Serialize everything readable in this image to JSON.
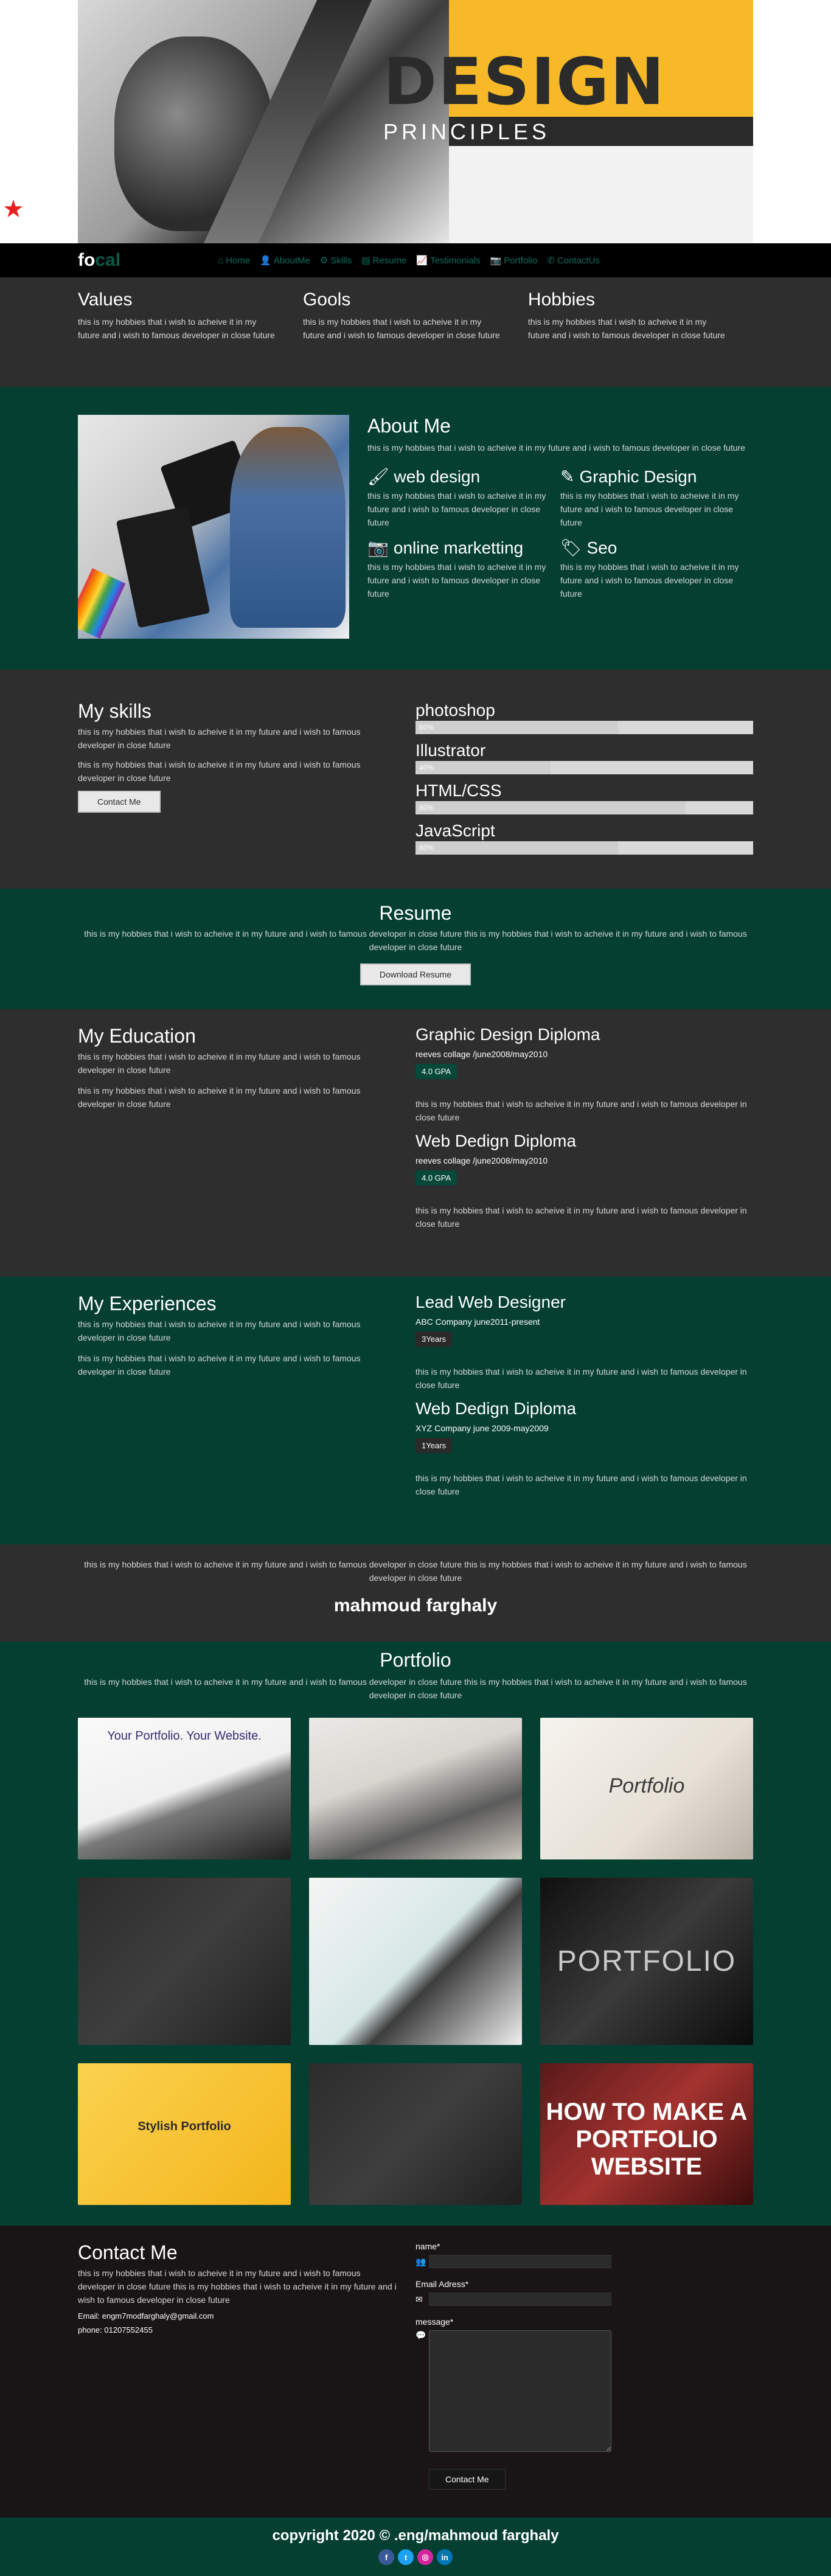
{
  "hero": {
    "word": "DESIGN",
    "sub": "PRINCIPLES"
  },
  "nav": {
    "brand_a": "fo",
    "brand_b": "cal",
    "items": [
      {
        "label": "Home",
        "icon": "home-icon"
      },
      {
        "label": "AboutMe",
        "icon": "user-icon"
      },
      {
        "label": "Skills",
        "icon": "gear-icon"
      },
      {
        "label": "Resume",
        "icon": "resume-icon"
      },
      {
        "label": "Testimonials",
        "icon": "chart-icon"
      },
      {
        "label": "Portfolio",
        "icon": "camera-icon"
      },
      {
        "label": "ContactUs",
        "icon": "phone-icon"
      }
    ]
  },
  "values": [
    {
      "title": "Values",
      "text": "this is my hobbies that i wish to acheive it in my future and i wish to famous developer in close future"
    },
    {
      "title": "Gools",
      "text": "this is my hobbies that i wish to acheive it in my future and i wish to famous developer in close future"
    },
    {
      "title": "Hobbies",
      "text": "this is my hobbies that i wish to acheive it in my future and i wish to famous developer in close future"
    }
  ],
  "about": {
    "title": "About Me",
    "text": "this is my hobbies that i wish to acheive it in my future and i wish to famous developer in close future",
    "cells": [
      {
        "title": "web design",
        "icon": "brush-icon",
        "text": "this is my hobbies that i wish to acheive it in my future and i wish to famous developer in close future"
      },
      {
        "title": "Graphic Design",
        "icon": "pen-icon",
        "text": "this is my hobbies that i wish to acheive it in my future and i wish to famous developer in close future"
      },
      {
        "title": "online marketting",
        "icon": "camera-icon",
        "text": "this is my hobbies that i wish to acheive it in my future and i wish to famous developer in close future"
      },
      {
        "title": "Seo",
        "icon": "tag-icon",
        "text": "this is my hobbies that i wish to acheive it in my future and i wish to famous developer in close future"
      }
    ]
  },
  "skills": {
    "title": "My skills",
    "text1": "this is my hobbies that i wish to acheive it in my future and i wish to famous developer in close future",
    "text2": "this is my hobbies that i wish to acheive it in my future and i wish to famous developer in close future",
    "button": "Contact Me",
    "items": [
      {
        "name": "photoshop",
        "percent": 60,
        "label": "60%"
      },
      {
        "name": "Illustrator",
        "percent": 40,
        "label": "40%"
      },
      {
        "name": "HTML/CSS",
        "percent": 80,
        "label": "80%"
      },
      {
        "name": "JavaScript",
        "percent": 60,
        "label": "60%"
      }
    ]
  },
  "resume": {
    "title": "Resume",
    "text": "this is my hobbies that i wish to acheive it in my future and i wish to famous developer in close future this is my hobbies that i wish to acheive it in my future and i wish to famous developer in close future",
    "button": "Download Resume"
  },
  "education": {
    "title": "My Education",
    "text1": "this is my hobbies that i wish to acheive it in my future and i wish to famous developer in close future",
    "text2": "this is my hobbies that i wish to acheive it in my future and i wish to famous developer in close future",
    "items": [
      {
        "title": "Graphic Design Diploma",
        "sub": "reeves collage /june2008/may2010",
        "badge": "4.0 GPA",
        "text": "this is my hobbies that i wish to acheive it in my future and i wish to famous developer in close future"
      },
      {
        "title": "Web Dedign Diploma",
        "sub": "reeves collage /june2008/may2010",
        "badge": "4.0 GPA",
        "text": "this is my hobbies that i wish to acheive it in my future and i wish to famous developer in close future"
      }
    ]
  },
  "experiences": {
    "title": "My Experiences",
    "text1": "this is my hobbies that i wish to acheive it in my future and i wish to famous developer in close future",
    "text2": "this is my hobbies that i wish to acheive it in my future and i wish to famous developer in close future",
    "items": [
      {
        "title": "Lead Web Designer",
        "sub": "ABC Company june2011-present",
        "badge": "3Years",
        "text": "this is my hobbies that i wish to acheive it in my future and i wish to famous developer in close future"
      },
      {
        "title": "Web Dedign Diploma",
        "sub": "XYZ Company june 2009-may2009",
        "badge": "1Years",
        "text": "this is my hobbies that i wish to acheive it in my future and i wish to famous developer in close future"
      }
    ]
  },
  "quote": {
    "text": "this is my hobbies that i wish to acheive it in my future and i wish to famous developer in close future this is my hobbies that i wish to acheive it in my future and i wish to famous developer in close future",
    "name": "mahmoud farghaly"
  },
  "portfolio": {
    "title": "Portfolio",
    "text": "this is my hobbies that i wish to acheive it in my future and i wish to famous developer in close future this is my hobbies that i wish to acheive it in my future and i wish to famous developer in close future",
    "tiles": [
      {
        "caption": "Your Portfolio. Your Website."
      },
      {
        "caption": ""
      },
      {
        "caption": "Portfolio"
      },
      {
        "caption": ""
      },
      {
        "caption": ""
      },
      {
        "caption": "PORTFOLIO"
      },
      {
        "caption": "Stylish Portfolio"
      },
      {
        "caption": ""
      },
      {
        "caption": "HOW TO MAKE A PORTFOLIO WEBSITE"
      }
    ]
  },
  "contact": {
    "title": "Contact Me",
    "text": "this is my hobbies that i wish to acheive it in my future and i wish to famous developer in close future this is my hobbies that i wish to acheive it in my future and i wish to famous developer in close future",
    "email": "Email: engm7modfarghaly@gmail.com",
    "phone_label": "phone:",
    "phone": "01207552455",
    "name_label": "name*",
    "email_label": "Email Adress*",
    "message_label": "message*",
    "button": "Contact Me"
  },
  "footer": {
    "text": "copyright 2020 © .eng/mahmoud farghaly",
    "social": [
      {
        "name": "facebook-icon",
        "glyph": "f",
        "color": "#3b5998"
      },
      {
        "name": "twitter-icon",
        "glyph": "t",
        "color": "#1da1f2"
      },
      {
        "name": "instagram-icon",
        "glyph": "◎",
        "color": "#d6249f"
      },
      {
        "name": "linkedin-icon",
        "glyph": "in",
        "color": "#0077b5"
      }
    ]
  }
}
